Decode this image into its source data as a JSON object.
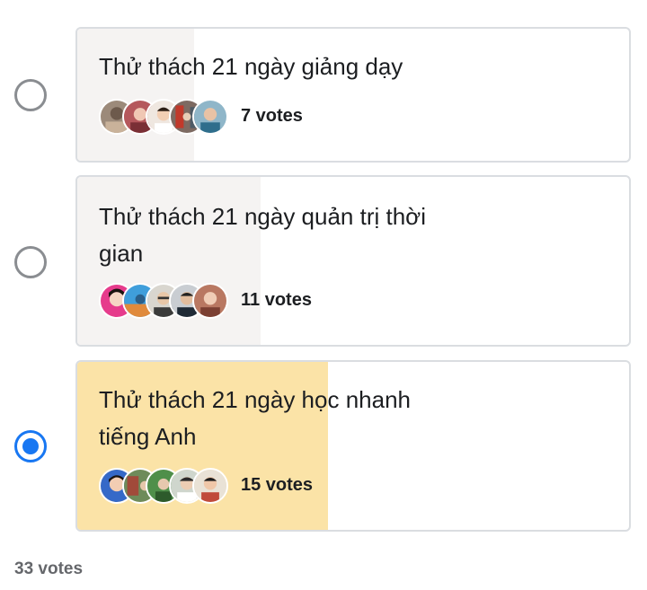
{
  "poll": {
    "options": [
      {
        "text": "Thử thách 21 ngày giảng dạy",
        "votes_label": "7 votes",
        "votes": 7,
        "selected": false,
        "avatars": [
          "voter-avatar-1",
          "voter-avatar-2",
          "voter-avatar-3",
          "voter-avatar-4",
          "voter-avatar-5"
        ]
      },
      {
        "text": "Thử thách 21 ngày quản trị thời gian",
        "votes_label": "11 votes",
        "votes": 11,
        "selected": false,
        "avatars": [
          "voter-avatar-1",
          "voter-avatar-2",
          "voter-avatar-3",
          "voter-avatar-4",
          "voter-avatar-5"
        ]
      },
      {
        "text": "Thử thách 21 ngày học nhanh tiếng Anh",
        "votes_label": "15 votes",
        "votes": 15,
        "selected": true,
        "avatars": [
          "voter-avatar-1",
          "voter-avatar-2",
          "voter-avatar-3",
          "voter-avatar-4",
          "voter-avatar-5"
        ]
      }
    ],
    "total_label": "33 votes",
    "total_votes": 33,
    "colors": {
      "accent": "#1877f2",
      "selected_fill": "#fbe3a7",
      "unselected_fill": "#f5f3f2",
      "border": "#dadde1"
    }
  }
}
